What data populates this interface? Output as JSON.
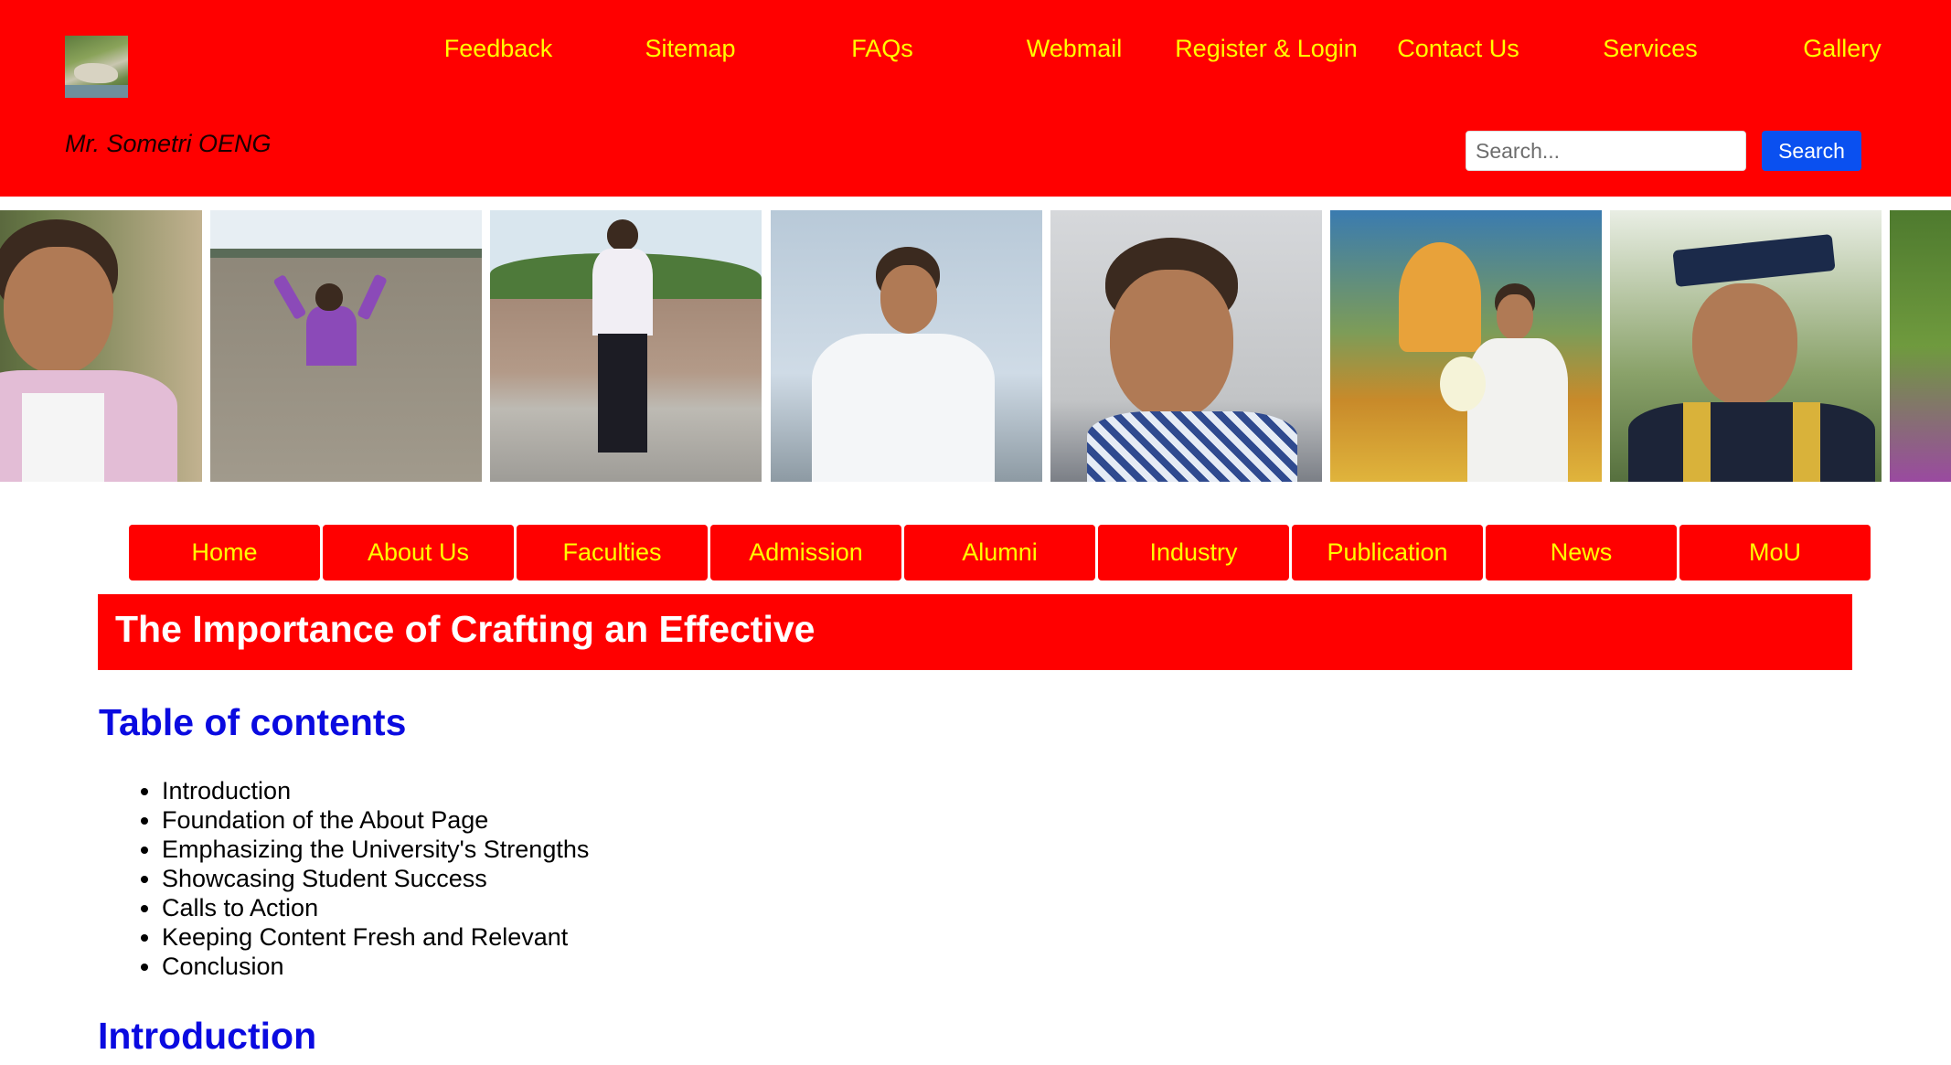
{
  "header": {
    "site_owner": "Mr. Sometri OENG",
    "top_links": [
      {
        "label": "Feedback"
      },
      {
        "label": "Sitemap"
      },
      {
        "label": "FAQs"
      },
      {
        "label": "Webmail"
      },
      {
        "label": "Register & Login"
      },
      {
        "label": "Contact Us"
      },
      {
        "label": "Services"
      },
      {
        "label": "Gallery"
      }
    ],
    "search": {
      "placeholder": "Search...",
      "button_label": "Search"
    },
    "colors": {
      "background": "#ff0000",
      "link": "#ffff00",
      "search_button": "#0a50f0"
    }
  },
  "main_nav": {
    "items": [
      {
        "label": "Home"
      },
      {
        "label": "About Us"
      },
      {
        "label": "Faculties"
      },
      {
        "label": "Admission"
      },
      {
        "label": "Alumni"
      },
      {
        "label": "Industry"
      },
      {
        "label": "Publication"
      },
      {
        "label": "News"
      },
      {
        "label": "MoU"
      }
    ]
  },
  "article": {
    "title": "The Importance of Crafting an Effective",
    "toc_heading": "Table of contents",
    "toc": [
      "Introduction",
      "Foundation of the About Page",
      "Emphasizing the University's Strengths",
      "Showcasing Student Success",
      "Calls to Action",
      "Keeping Content Fresh and Relevant",
      "Conclusion"
    ],
    "first_section_heading": "Introduction"
  },
  "icons": {
    "logo": "landscape-logo-icon"
  }
}
